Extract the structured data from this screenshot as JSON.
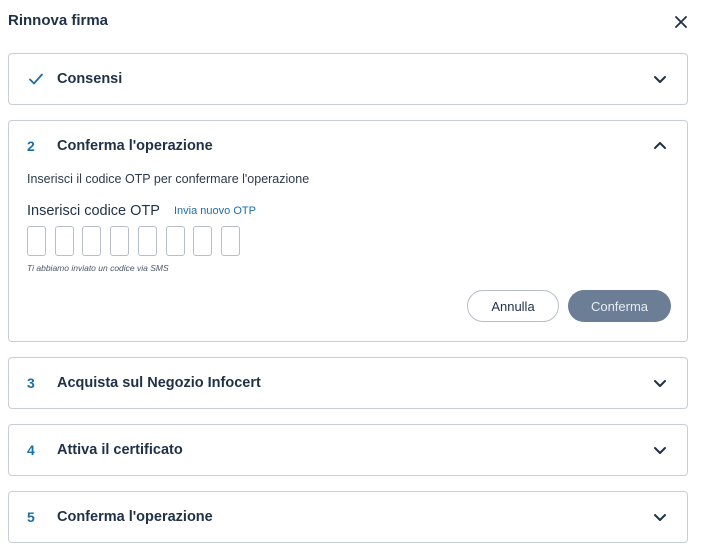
{
  "dialog": {
    "title": "Rinnova firma"
  },
  "steps": [
    {
      "marker": "check",
      "label": "Consensi",
      "state": "completed"
    },
    {
      "marker": "2",
      "label": "Conferma l'operazione",
      "state": "expanded",
      "description": "Inserisci il codice OTP per confermare l'operazione",
      "otp_label": "Inserisci codice OTP",
      "resend_link": "Invia nuovo OTP",
      "otp_length": 8,
      "sms_note": "Ti abbiamo inviato un codice via SMS",
      "cancel_label": "Annulla",
      "confirm_label": "Conferma"
    },
    {
      "marker": "3",
      "label": "Acquista sul Negozio Infocert",
      "state": "collapsed"
    },
    {
      "marker": "4",
      "label": "Attiva il certificato",
      "state": "collapsed"
    },
    {
      "marker": "5",
      "label": "Conferma l'operazione",
      "state": "collapsed"
    }
  ],
  "colors": {
    "accent": "#1b6fa8",
    "text": "#1f3047",
    "border": "#c9ced6",
    "confirm_disabled_bg": "#6b7e96"
  },
  "icons": {
    "close": "close-icon",
    "check": "check-icon",
    "collapse": "chevron-down-icon",
    "expand": "chevron-up-icon"
  }
}
